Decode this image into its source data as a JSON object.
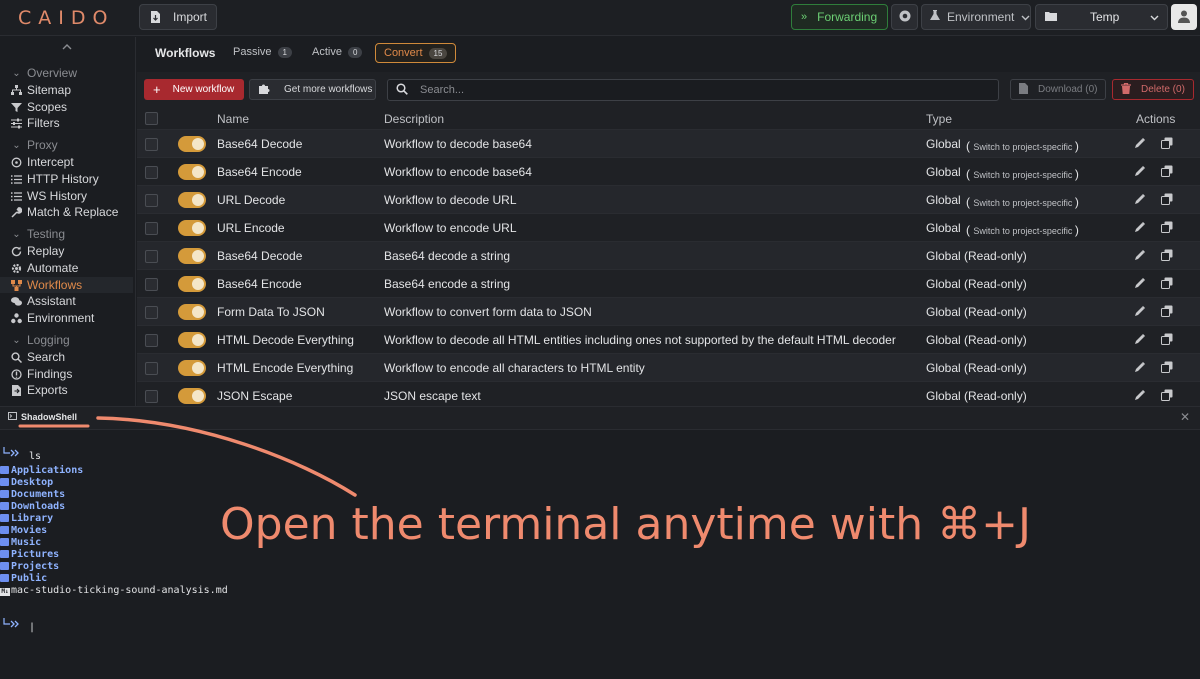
{
  "app": {
    "logo": "CAIDO"
  },
  "topbar": {
    "import_label": "Import",
    "forwarding_label": "Forwarding",
    "environment_label": "Environment",
    "project_label": "Temp"
  },
  "sidebar": {
    "groups": [
      {
        "label": "Overview",
        "items": [
          "Sitemap",
          "Scopes",
          "Filters"
        ]
      },
      {
        "label": "Proxy",
        "items": [
          "Intercept",
          "HTTP History",
          "WS History",
          "Match & Replace"
        ]
      },
      {
        "label": "Testing",
        "items": [
          "Replay",
          "Automate",
          "Workflows",
          "Assistant",
          "Environment"
        ]
      },
      {
        "label": "Logging",
        "items": [
          "Search",
          "Findings",
          "Exports"
        ]
      }
    ]
  },
  "main": {
    "title": "Workflows",
    "tabs": [
      {
        "label": "Passive",
        "count": "1"
      },
      {
        "label": "Active",
        "count": "0"
      },
      {
        "label": "Convert",
        "count": "15"
      }
    ],
    "new_workflow_label": "New workflow",
    "get_more_label": "Get more workflows",
    "search_placeholder": "Search...",
    "download_label": "Download (0)",
    "delete_label": "Delete (0)",
    "columns": {
      "name": "Name",
      "description": "Description",
      "type": "Type",
      "actions": "Actions"
    },
    "rows": [
      {
        "name": "Base64 Decode",
        "description": "Workflow to decode base64",
        "type": "Global",
        "switch": "Switch to project-specific"
      },
      {
        "name": "Base64 Encode",
        "description": "Workflow to encode base64",
        "type": "Global",
        "switch": "Switch to project-specific"
      },
      {
        "name": "URL Decode",
        "description": "Workflow to decode URL",
        "type": "Global",
        "switch": "Switch to project-specific"
      },
      {
        "name": "URL Encode",
        "description": "Workflow to encode URL",
        "type": "Global",
        "switch": "Switch to project-specific"
      },
      {
        "name": "Base64 Decode",
        "description": "Base64 decode a string",
        "type": "Global (Read-only)",
        "switch": ""
      },
      {
        "name": "Base64 Encode",
        "description": "Base64 encode a string",
        "type": "Global (Read-only)",
        "switch": ""
      },
      {
        "name": "Form Data To JSON",
        "description": "Workflow to convert form data to JSON",
        "type": "Global (Read-only)",
        "switch": ""
      },
      {
        "name": "HTML Decode Everything",
        "description": "Workflow to decode all HTML entities including ones not supported by the default HTML decoder",
        "type": "Global (Read-only)",
        "switch": ""
      },
      {
        "name": "HTML Encode Everything",
        "description": "Workflow to encode all characters to HTML entity",
        "type": "Global (Read-only)",
        "switch": ""
      },
      {
        "name": "JSON Escape",
        "description": "JSON escape text",
        "type": "Global (Read-only)",
        "switch": ""
      }
    ]
  },
  "terminal": {
    "tab_label": "ShadowShell",
    "command": "ls",
    "directories": [
      "Applications",
      "Desktop",
      "Documents",
      "Downloads",
      "Library",
      "Movies",
      "Music",
      "Pictures",
      "Projects",
      "Public"
    ],
    "file": "mac-studio-ticking-sound-analysis.md",
    "annotation": "Open the terminal anytime with ⌘+J"
  },
  "colors": {
    "accent": "#e08a4a",
    "danger": "#a8292f",
    "success": "#6ccf74",
    "annotation": "#ef8a6e"
  }
}
